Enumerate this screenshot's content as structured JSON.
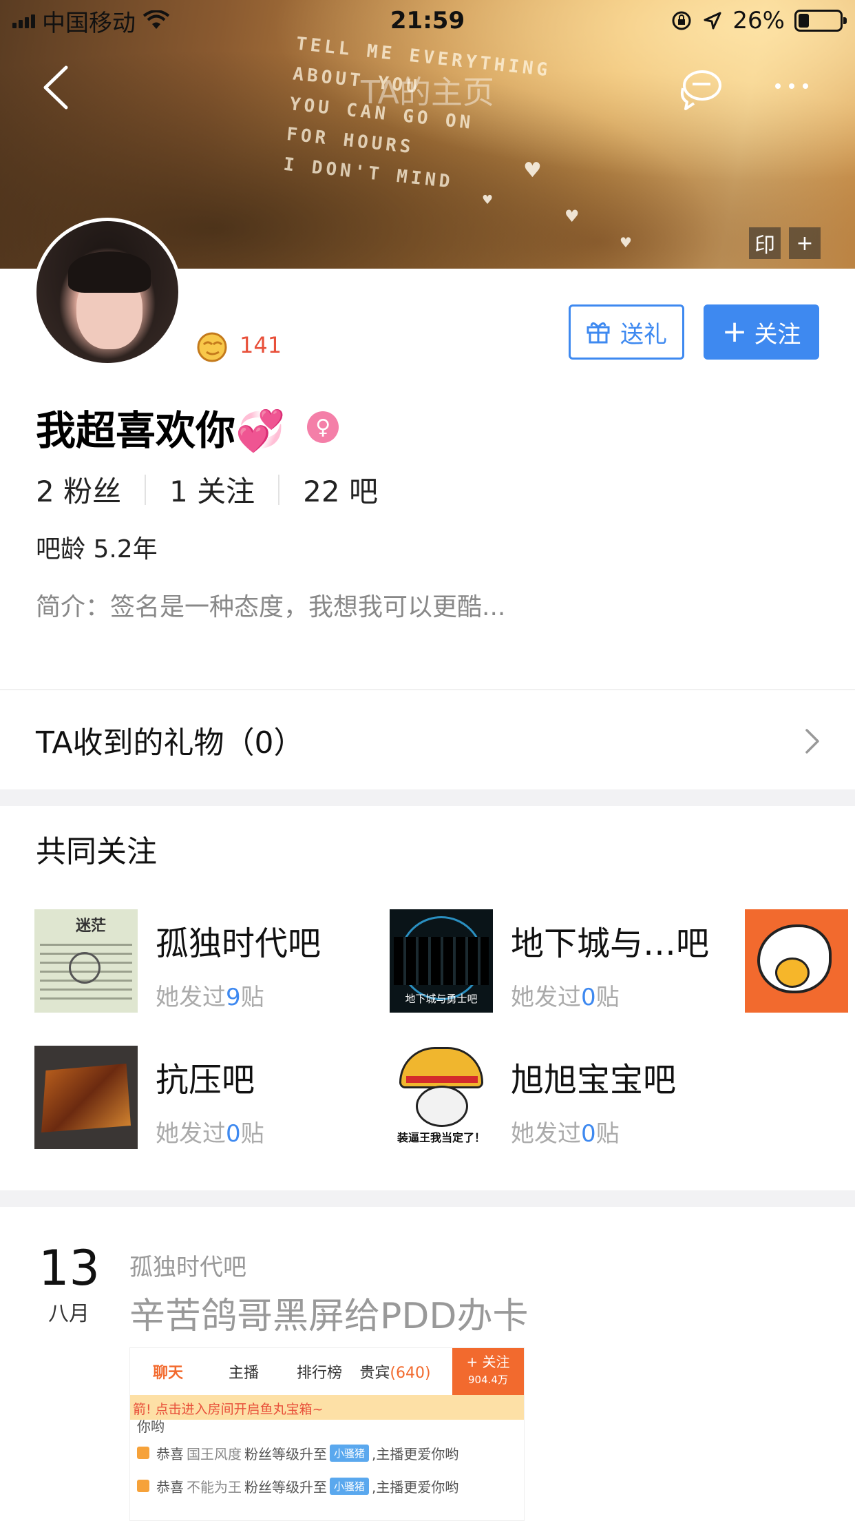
{
  "status_bar": {
    "carrier": "中国移动",
    "time": "21:59",
    "battery_percent": "26%",
    "battery_level": 0.26
  },
  "nav": {
    "title": "TA的主页",
    "icons": [
      "back-icon",
      "chat-bubbles-icon",
      "more-icon"
    ]
  },
  "banner": {
    "poem_lines": [
      "TELL ME EVERYTHING",
      "ABOUT YOU",
      "YOU CAN GO ON",
      "FOR HOURS",
      "I DON'T MIND"
    ],
    "stamp_label": "印",
    "add_label": "+"
  },
  "profile": {
    "level": "141",
    "username": "我超喜欢你💞",
    "gender_symbol": "♀",
    "stats": [
      {
        "label": "2 粉丝"
      },
      {
        "label": "1 关注"
      },
      {
        "label": "22 吧"
      }
    ],
    "age": "吧龄 5.2年",
    "bio": "简介：签名是一种态度，我想我可以更酷..."
  },
  "actions": {
    "gift_label": "送礼",
    "follow_label": "关注",
    "follow_plus": "+"
  },
  "gifts": {
    "label": "TA收到的礼物（0）"
  },
  "mutual": {
    "title": "共同关注",
    "bars": [
      {
        "name": "孤独时代吧",
        "prefix": "她发过",
        "count": "9",
        "suffix": "贴",
        "thumb_text": "迷茫"
      },
      {
        "name": "地下城与…吧",
        "prefix": "她发过",
        "count": "0",
        "suffix": "贴",
        "thumb_text": "地下城与勇士吧"
      },
      {
        "name": "抗压吧",
        "prefix": "她发过",
        "count": "0",
        "suffix": "贴"
      },
      {
        "name": "旭旭宝宝吧",
        "prefix": "她发过",
        "count": "0",
        "suffix": "贴",
        "thumb_text": "装逼王我当定了！"
      }
    ]
  },
  "post": {
    "day": "13",
    "month": "八月",
    "forum": "孤独时代吧",
    "title": "辛苦鸽哥黑屏给PDD办卡",
    "image": {
      "tabs": [
        "聊天",
        "主播",
        "排行榜",
        "贵宾"
      ],
      "guest_count": "(640)",
      "follow_label": "+ 关注",
      "follow_count": "904.4万",
      "banner": "箭! 点击进入房间开启鱼丸宝箱~",
      "line0": "你哟",
      "lines": [
        {
          "lead": "恭喜",
          "name": "国王风度",
          "mid": "粉丝等级升至",
          "tag": "小骚猪",
          "tail": ",主播更爱你哟"
        },
        {
          "lead": "恭喜",
          "name": "不能为王",
          "mid": "粉丝等级升至",
          "tag": "小骚猪",
          "tail": ",主播更爱你哟"
        }
      ]
    }
  }
}
